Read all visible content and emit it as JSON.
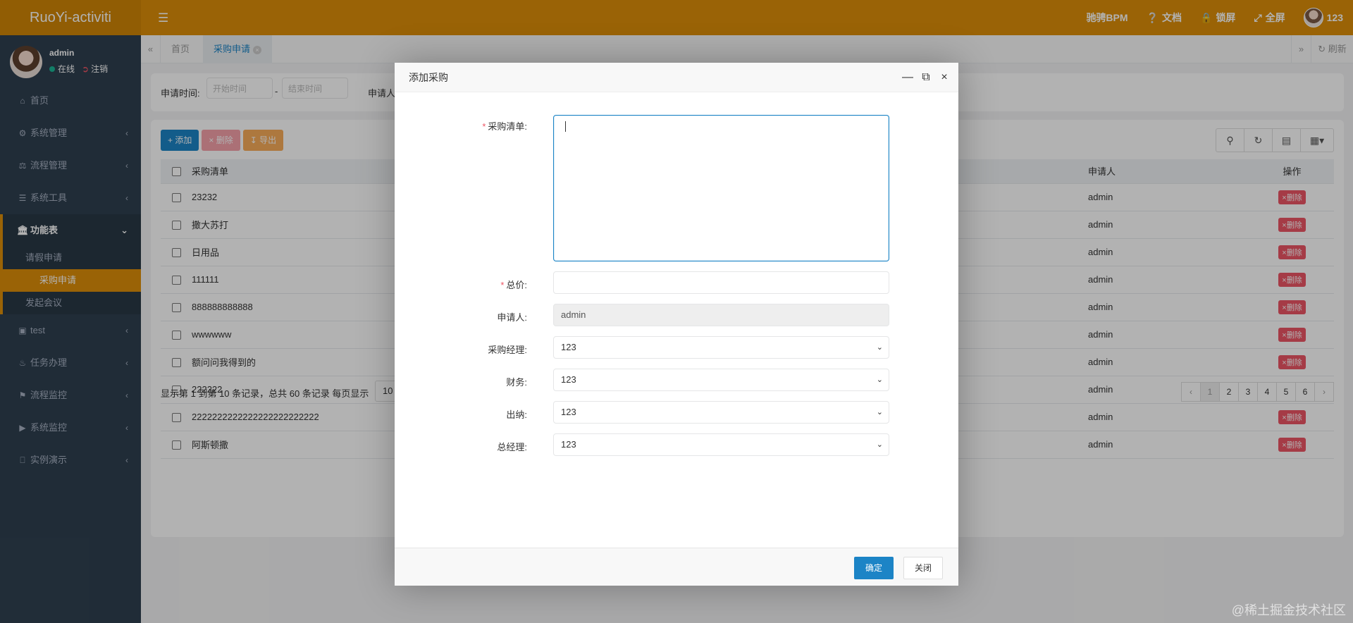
{
  "brand": "RuoYi-activiti",
  "icons": {
    "menu": "menu-icon",
    "help": "question-circle-icon",
    "lock": "lock-icon",
    "fullscreen": "expand-icon"
  },
  "colors": {
    "accent": "#dd8f0a",
    "sidebar": "#2f4050",
    "primary": "#1c84c6",
    "danger": "#ed5565",
    "warning": "#f8ac59"
  },
  "topnav": {
    "bpm": "驰骋BPM",
    "docs": "文档",
    "lock": "锁屏",
    "fullscreen": "全屏",
    "user": "123"
  },
  "profile": {
    "name": "admin",
    "online": "在线",
    "logout": "注销"
  },
  "sidebar": {
    "items": [
      {
        "label": "首页",
        "icon": "home-icon"
      },
      {
        "label": "系统管理",
        "icon": "gear-icon"
      },
      {
        "label": "流程管理",
        "icon": "balance-icon"
      },
      {
        "label": "系统工具",
        "icon": "bars-icon"
      },
      {
        "label": "功能表",
        "icon": "bank-icon"
      },
      {
        "label": "test",
        "icon": "book-icon"
      },
      {
        "label": "任务办理",
        "icon": "bell-icon"
      },
      {
        "label": "流程监控",
        "icon": "binoculars-icon"
      },
      {
        "label": "系统监控",
        "icon": "video-icon"
      },
      {
        "label": "实例演示",
        "icon": "desktop-icon"
      }
    ],
    "sub": [
      "请假申请",
      "采购申请",
      "发起会议"
    ]
  },
  "tabs": {
    "home": "首页",
    "current": "采购申请",
    "refresh": "刷新"
  },
  "search": {
    "date_label": "申请时间:",
    "start_placeholder": "开始时间",
    "end_placeholder": "结束时间",
    "applicant_label": "申请人"
  },
  "toolbar": {
    "add": "添加",
    "delete": "删除",
    "export": "导出"
  },
  "table": {
    "headers": {
      "item": "采购清单",
      "user": "申请人",
      "op": "操作"
    },
    "delete_label": "删除",
    "rows": [
      {
        "item": "23232",
        "user": "admin"
      },
      {
        "item": "撒大苏打",
        "user": "admin"
      },
      {
        "item": "日用品",
        "user": "admin"
      },
      {
        "item": "111111",
        "user": "admin"
      },
      {
        "item": "888888888888",
        "user": "admin"
      },
      {
        "item": "wwwwww",
        "user": "admin"
      },
      {
        "item": "额问问我得到的",
        "user": "admin"
      },
      {
        "item": "222222",
        "user": "admin"
      },
      {
        "item": "2222222222222222222222222",
        "user": "admin"
      },
      {
        "item": "阿斯顿撒",
        "user": "admin"
      }
    ]
  },
  "pager": {
    "info": "显示第 1 到第 10 条记录，总共 60 条记录  每页显示",
    "size": "10",
    "prev": "‹",
    "next": "›",
    "pages": [
      "1",
      "2",
      "3",
      "4",
      "5",
      "6"
    ],
    "current": "1"
  },
  "modal": {
    "title": "添加采购",
    "fields": {
      "list_label": "采购清单:",
      "list_value": "",
      "total_label": "总价:",
      "total_value": "",
      "applicant_label": "申请人:",
      "applicant_value": "admin",
      "manager_label": "采购经理:",
      "manager_value": "123",
      "finance_label": "财务:",
      "finance_value": "123",
      "cashier_label": "出纳:",
      "cashier_value": "123",
      "gm_label": "总经理:",
      "gm_value": "123"
    },
    "ok": "确定",
    "close": "关闭"
  },
  "watermark": "@稀土掘金技术社区"
}
